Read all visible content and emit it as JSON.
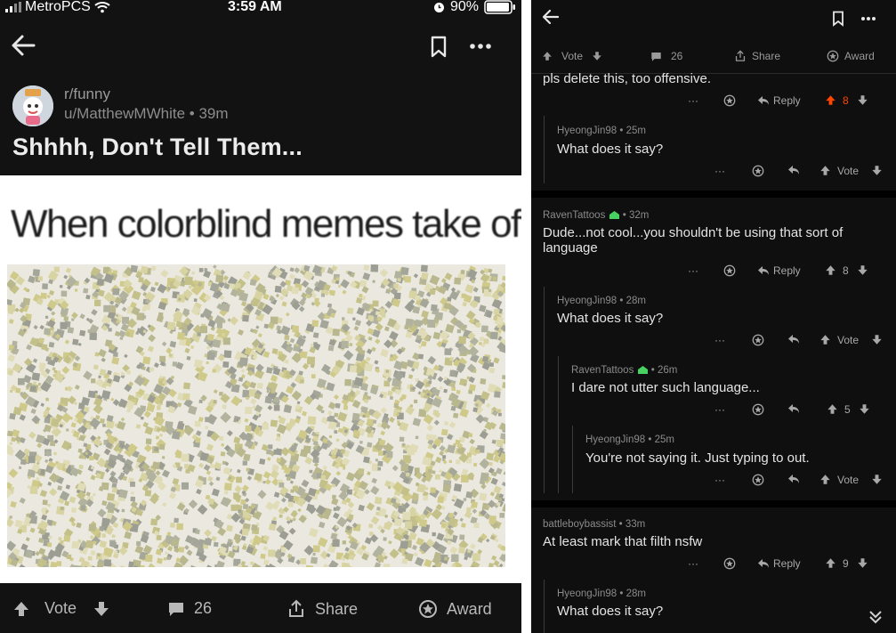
{
  "status": {
    "carrier": "MetroPCS",
    "time": "3:59 AM",
    "battery": "90%"
  },
  "post": {
    "subreddit": "r/funny",
    "user": "u/MatthewMWhite",
    "age": "39m",
    "title": "Shhhh, Don't Tell Them...",
    "image_caption": "When colorblind memes take off"
  },
  "bottom_bar": {
    "vote": "Vote",
    "comments": "26",
    "share": "Share",
    "award": "Award"
  },
  "right_header": {
    "vote": "Vote",
    "comments": "26",
    "share": "Share",
    "award": "Award"
  },
  "comments": {
    "c0": {
      "text": "pls delete this, too offensive.",
      "reply": "Reply",
      "score": "8"
    },
    "c1": {
      "author": "HyeongJin98",
      "age": "25m",
      "text": "What does it say?",
      "vote": "Vote"
    },
    "c2": {
      "author": "RavenTattoos",
      "age": "32m",
      "text": "Dude...not cool...you shouldn't be using that sort of language",
      "reply": "Reply",
      "score": "8"
    },
    "c3": {
      "author": "HyeongJin98",
      "age": "28m",
      "text": "What does it say?",
      "vote": "Vote"
    },
    "c4": {
      "author": "RavenTattoos",
      "age": "26m",
      "text": "I dare not utter such language...",
      "score": "5"
    },
    "c5": {
      "author": "HyeongJin98",
      "age": "25m",
      "text": "You're not saying it. Just typing to out.",
      "vote": "Vote"
    },
    "c6": {
      "author": "battleboybassist",
      "age": "33m",
      "text": "At least mark that filth nsfw",
      "reply": "Reply",
      "score": "9"
    },
    "c7": {
      "author": "HyeongJin98",
      "age": "28m",
      "text": "What does it say?"
    }
  },
  "colors": {
    "upvoted": "#ff4500",
    "mod_green": "#46d160",
    "dot_yellow": "#cfc98a",
    "dot_gray": "#a5a69a"
  }
}
